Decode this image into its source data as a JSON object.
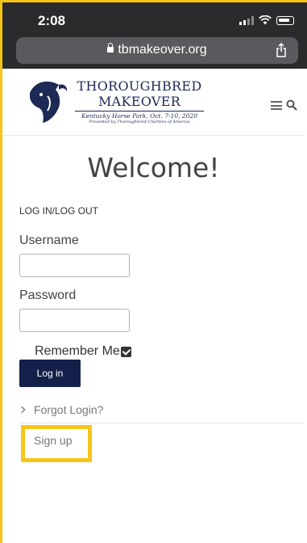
{
  "status_bar": {
    "time": "2:08"
  },
  "browser": {
    "url": "tbmakeover.org"
  },
  "site_header": {
    "brand_line1": "THOROUGHBRED",
    "brand_line2": "MAKEOVER",
    "brand_event": "Kentucky Horse Park, Oct. 7-10, 2020",
    "brand_presenter": "Presented by Thoroughbred Charities of America"
  },
  "main": {
    "title": "Welcome!",
    "section_heading": "LOG IN/LOG OUT",
    "username_label": "Username",
    "username_value": "",
    "password_label": "Password",
    "password_value": "",
    "remember_label": "Remember Me",
    "remember_checked": true,
    "login_button": "Log in",
    "forgot_link": "Forgot Login?",
    "signup_link": "Sign up"
  },
  "colors": {
    "highlight": "#f5c518",
    "brand_navy": "#1c2a55",
    "button_bg": "#14204a",
    "chrome_bg": "#2b2b2d"
  },
  "icons": [
    "lock-icon",
    "share-icon",
    "horse-logo",
    "menu-icon",
    "search-icon",
    "checkbox-checked-icon",
    "chevron-right-icon"
  ]
}
